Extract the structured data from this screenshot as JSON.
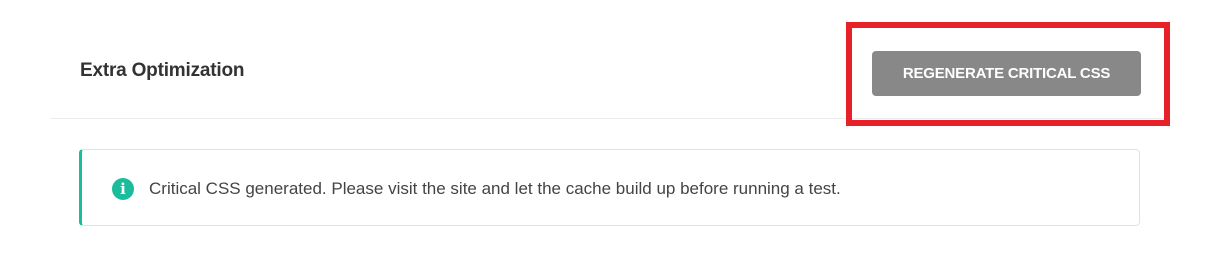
{
  "section": {
    "title": "Extra Optimization"
  },
  "toolbar": {
    "regenerate_label": "REGENERATE CRITICAL CSS"
  },
  "notice": {
    "icon": "info-icon",
    "icon_glyph": "i",
    "message": "Critical CSS generated. Please visit the site and let the cache build up before running a test."
  },
  "colors": {
    "accent": "#1abc9c",
    "button_bg": "#888888",
    "highlight": "#e8202a"
  }
}
